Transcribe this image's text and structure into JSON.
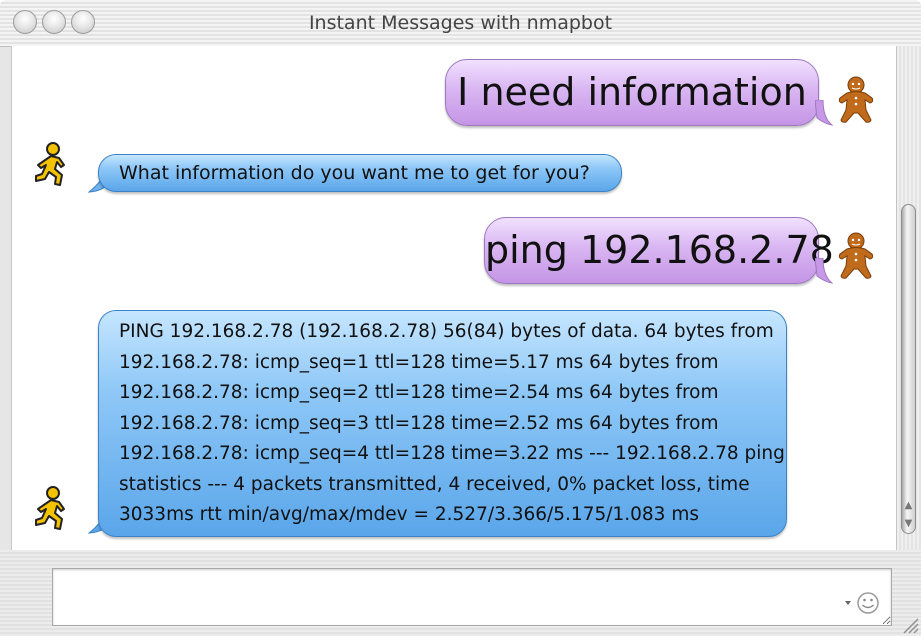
{
  "window": {
    "title": "Instant Messages with nmapbot"
  },
  "messages": [
    {
      "sender": "self",
      "text": "I need information"
    },
    {
      "sender": "bot",
      "text": "What information do you want me to get for you?"
    },
    {
      "sender": "self",
      "text": "ping 192.168.2.78"
    },
    {
      "sender": "bot",
      "lines": [
        "PING 192.168.2.78 (192.168.2.78) 56(84) bytes of data. 64 bytes from",
        "192.168.2.78: icmp_seq=1 ttl=128 time=5.17 ms 64 bytes from",
        "192.168.2.78: icmp_seq=2 ttl=128 time=2.54 ms 64 bytes from",
        "192.168.2.78: icmp_seq=3 ttl=128 time=2.52 ms 64 bytes from",
        "192.168.2.78: icmp_seq=4 ttl=128 time=3.22 ms --- 192.168.2.78 ping",
        "statistics --- 4 packets transmitted, 4 received, 0% packet loss, time",
        "3033ms rtt min/avg/max/mdev = 2.527/3.366/5.175/1.083 ms"
      ]
    }
  ],
  "input": {
    "value": ""
  },
  "icons": {
    "close": "close-icon",
    "minimize": "minimize-icon",
    "zoom": "zoom-icon",
    "self_avatar": "gingerbread-avatar-icon",
    "bot_avatar": "aim-running-man-icon",
    "smiley": "smiley-icon",
    "resize": "resize-grip-icon"
  },
  "colors": {
    "self_bubble": "#d9b6f2",
    "bot_bubble": "#8fc8f7",
    "aim_yellow": "#f5c200"
  }
}
